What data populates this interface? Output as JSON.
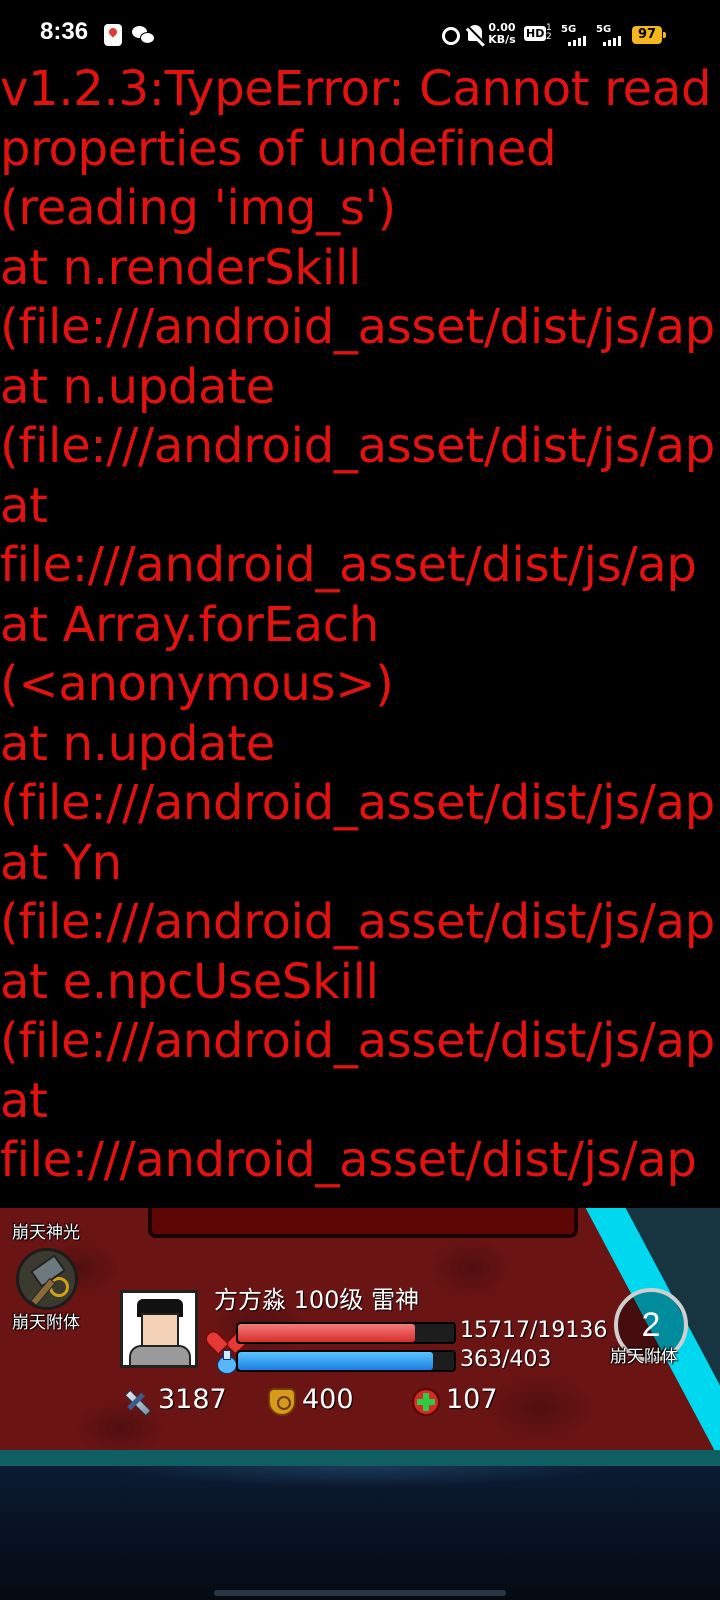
{
  "status_bar": {
    "time": "8:36",
    "net_speed_value": "0.00",
    "net_speed_unit": "KB/s",
    "hd_label": "HD",
    "hd_sub": "1\n2",
    "signal_1": "5G",
    "signal_2": "5G",
    "battery": "97",
    "icons": [
      "map-icon",
      "wechat-icon",
      "alarm-icon",
      "bell-off-icon",
      "hd-icon",
      "signal-icon",
      "battery-icon"
    ]
  },
  "error": {
    "text": "v1.2.3:TypeError: Cannot read\nproperties of undefined\n(reading 'img_s')\nat n.renderSkill\n(file:///android_asset/dist/js/ap\nat n.update\n(file:///android_asset/dist/js/ap\nat\nfile:///android_asset/dist/js/ap\nat Array.forEach\n(<anonymous>)\nat n.update\n(file:///android_asset/dist/js/ap\nat Yn\n(file:///android_asset/dist/js/ap\nat e.npcUseSkill\n(file:///android_asset/dist/js/ap\nat\nfile:///android_asset/dist/js/ap",
    "color": "#e1120f"
  },
  "game": {
    "skill_top_label": "崩天神光",
    "skill_bottom_label": "崩天附体",
    "player_name": "方方淼 100级 雷神",
    "hp_text": "15717/19136",
    "hp_fraction": 0.8213,
    "mp_text": "363/403",
    "mp_fraction": 0.9007,
    "attack": "3187",
    "defense": "400",
    "heal": "107",
    "counter_value": "2",
    "counter_label": "崩天附体",
    "colors": {
      "hp": "#d8302f",
      "mp": "#1b7fe0",
      "panel": "#6b1414",
      "accent": "#00d8f0"
    }
  }
}
